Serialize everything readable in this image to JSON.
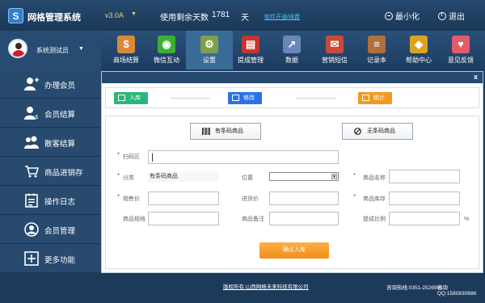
{
  "topbar": {
    "logo_letter": "S",
    "app_title": "网格管理系统",
    "version": "v3.0A",
    "version_caret": "▼",
    "days_label": "使用剩余天数",
    "days_value": "1781",
    "days_unit": "天",
    "renew_link": "软件开通/续费",
    "minimize_label": "最小化",
    "exit_label": "退出"
  },
  "user": {
    "name": "系统测试员",
    "caret": "▼"
  },
  "nav": [
    {
      "label": "商场结算",
      "icon": "dollar-icon",
      "glyph": "$",
      "color": "#d9893a"
    },
    {
      "label": "微信互动",
      "icon": "wechat-icon",
      "glyph": "◉",
      "color": "#3cb034"
    },
    {
      "label": "设置",
      "icon": "settings-icon",
      "glyph": "⚙",
      "color": "#7fa04a"
    },
    {
      "label": "提成管理",
      "icon": "commission-icon",
      "glyph": "▤",
      "color": "#c7342f"
    },
    {
      "label": "数据",
      "icon": "data-chart-icon",
      "glyph": "↗",
      "color": "#6b86b8"
    },
    {
      "label": "营销短信",
      "icon": "sms-icon",
      "glyph": "✉",
      "color": "#c94a3a"
    },
    {
      "label": "记录本",
      "icon": "notebook-icon",
      "glyph": "≡",
      "color": "#b0703b"
    },
    {
      "label": "帮助中心",
      "icon": "help-icon",
      "glyph": "◆",
      "color": "#d9a321"
    },
    {
      "label": "意见反馈",
      "icon": "feedback-icon",
      "glyph": "♥",
      "color": "#e35a6a"
    }
  ],
  "sidebar": [
    {
      "label": "办理会员",
      "icon": "add-member-icon"
    },
    {
      "label": "会员结算",
      "icon": "member-checkout-icon"
    },
    {
      "label": "散客结算",
      "icon": "guest-checkout-icon"
    },
    {
      "label": "商品进销存",
      "icon": "cart-icon"
    },
    {
      "label": "操作日志",
      "icon": "log-icon"
    },
    {
      "label": "会员管理",
      "icon": "member-manage-icon"
    },
    {
      "label": "更多功能",
      "icon": "more-icon"
    }
  ],
  "panel": {
    "close": "x",
    "steps": [
      {
        "label": "入库",
        "icon": "stock-in-icon",
        "color": "#29b77c"
      },
      {
        "label": "修改",
        "icon": "edit-icon",
        "color": "#2a72e6"
      },
      {
        "label": "统计",
        "icon": "statistics-icon",
        "color": "#f29a1f"
      }
    ],
    "barcode_button": "有条码商品",
    "no_barcode_button": "无条码商品",
    "fields": {
      "scan_label": "扫码区",
      "category_label": "分类",
      "category_value": "有条码商品",
      "location_label": "位置",
      "name_label": "商品名称",
      "sale_price_label": "销售价",
      "purchase_price_label": "进货价",
      "stock_label": "商品库存",
      "spec_label": "商品规格",
      "note_label": "商品备注",
      "commission_label": "提成比例",
      "percent": "%"
    },
    "confirm_button": "确认入库"
  },
  "footer": {
    "copyright": "版权所有:山西网格未来科技有限公司",
    "hotline": "咨询热线:0351-2526991",
    "qq": "咨询QQ:1580830686"
  }
}
